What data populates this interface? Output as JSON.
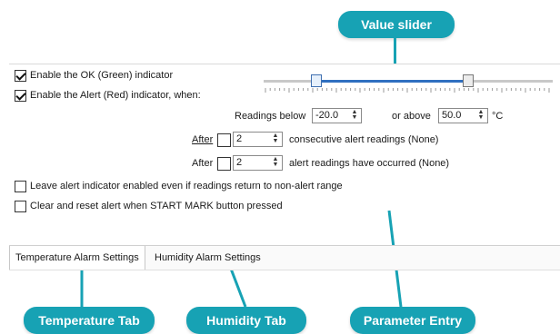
{
  "callouts": {
    "value_slider": "Value slider",
    "temperature_tab": "Temperature Tab",
    "humidity_tab": "Humidity Tab",
    "parameter_entry": "Parameter Entry"
  },
  "settings": {
    "ok_indicator_label": "Enable the OK (Green) indicator",
    "ok_indicator_checked": true,
    "alert_indicator_label": "Enable the Alert (Red) indicator, when:",
    "alert_indicator_checked": true,
    "readings_below_label": "Readings below",
    "readings_below_value": "-20.0",
    "or_above_label": "or above",
    "or_above_value": "50.0",
    "unit": "°C",
    "after_label_1": "After",
    "after_value_1": "2",
    "after_text_1": "consecutive alert readings (None)",
    "after_label_2": "After",
    "after_value_2": "2",
    "after_text_2": "alert readings have occurred (None)",
    "leave_alert_label": "Leave alert indicator enabled even if readings return to non-alert range",
    "leave_alert_checked": false,
    "clear_reset_label": "Clear and reset alert when START MARK button pressed",
    "clear_reset_checked": false
  },
  "tabs": [
    {
      "label": "Temperature Alarm Settings",
      "active": true
    },
    {
      "label": "Humidity Alarm Settings",
      "active": false
    }
  ],
  "colors": {
    "callout": "#17a2b4",
    "slider_range": "#2f6fc0"
  }
}
